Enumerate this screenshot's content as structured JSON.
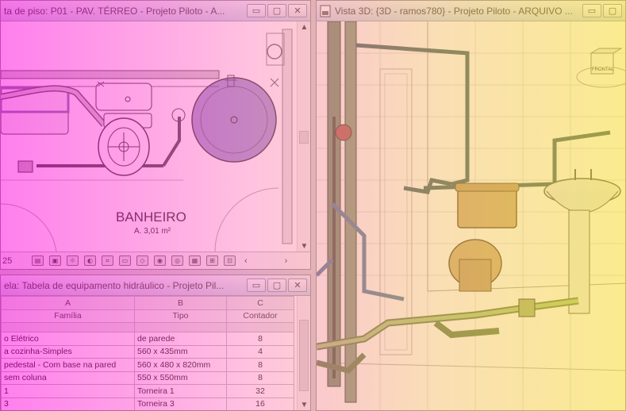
{
  "floor_plan": {
    "title": "ta de piso: P01 - PAV. TÉRREO - Projeto Piloto - A...",
    "room_name": "BANHEIRO",
    "room_area": "A. 3,01 m²",
    "scale": "25",
    "toolbar_icons": [
      "detail-level-icon",
      "visual-style-icon",
      "sun-path-icon",
      "shadows-icon",
      "crop-view-icon",
      "show-crop-icon",
      "unlock-3d-icon",
      "temporary-hide-icon",
      "reveal-hidden-icon",
      "worksharing-icon",
      "design-options-icon",
      "analysis-icon"
    ],
    "accent": "#4a3fa0"
  },
  "view3d": {
    "title": "Vista 3D: {3D - ramos780} - Projeto Piloto - ARQUIVO ...",
    "viewcube_label": "FRONTAL"
  },
  "schedule": {
    "title": "ela: Tabela de equipamento hidráulico - Projeto Pil...",
    "col_letters": [
      "A",
      "B",
      "C"
    ],
    "headers": [
      "Família",
      "Tipo",
      "Contador"
    ],
    "rows": [
      {
        "familia": "o Elétrico",
        "tipo": "de parede",
        "contador": "8"
      },
      {
        "familia": "a cozinha-Simples",
        "tipo": "560 x 435mm",
        "contador": "4"
      },
      {
        "familia": "pedestal - Com base na pared",
        "tipo": "560 x 480 x 820mm",
        "contador": "8"
      },
      {
        "familia": "sem coluna",
        "tipo": "550 x 550mm",
        "contador": "8"
      },
      {
        "familia": "1",
        "tipo": "Torneira 1",
        "contador": "32"
      },
      {
        "familia": "3",
        "tipo": "Torneira 3",
        "contador": "16"
      }
    ]
  },
  "window_buttons": {
    "minimize": "▭",
    "restore": "▢",
    "close": "✕"
  },
  "colors": {
    "overlay_left": "#ff00dc",
    "overlay_right": "#ffe128",
    "pipe": "#4f6a4f",
    "fixture": "#c7a677"
  }
}
